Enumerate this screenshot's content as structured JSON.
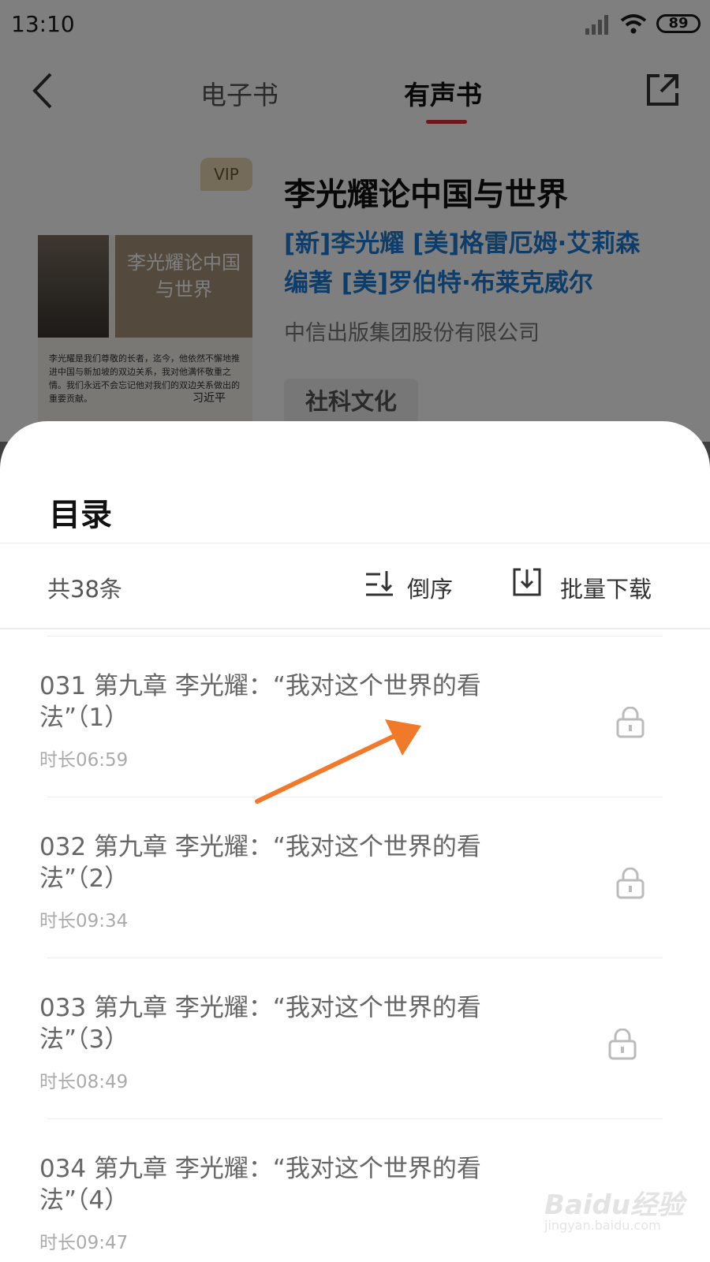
{
  "status_bar": {
    "time": "13:10",
    "battery": "89"
  },
  "nav": {
    "tabs": [
      {
        "label": "电子书"
      },
      {
        "label": "有声书"
      }
    ],
    "accent_color": "#d6323a"
  },
  "book": {
    "vip_label": "VIP",
    "title": "李光耀论中国与世界",
    "authors": "[新]李光耀 [美]格雷厄姆·艾莉森 编著 [美]罗伯特·布莱克威尔",
    "publisher": "中信出版集团股份有限公司",
    "tag": "社科文化",
    "cover": {
      "title": "李光耀论中国与世界",
      "quote": "李光耀是我们尊敬的长者，迄今，他依然不懈地推进中国与新加坡的双边关系，我对他满怀敬重之情。我们永远不会忘记他对我们的双边关系做出的重要贡献。",
      "signature": "习近平"
    }
  },
  "sheet": {
    "title": "目录",
    "count": "共38条",
    "sort_label": "倒序",
    "download_label": "批量下载",
    "items": [
      {
        "title": "031 第九章 李光耀：“我对这个世界的看法”（1）",
        "duration": "时长06:59"
      },
      {
        "title": "032 第九章 李光耀：“我对这个世界的看法”（2）",
        "duration": "时长09:34"
      },
      {
        "title": "033 第九章 李光耀：“我对这个世界的看法”（3）",
        "duration": "时长08:49"
      },
      {
        "title": "034 第九章 李光耀：“我对这个世界的看法”（4）",
        "duration": "时长09:47"
      }
    ]
  },
  "annotation_color": "#f07a2a",
  "watermark": {
    "main": "Baidu经验",
    "sub": "jingyan.baidu.com"
  }
}
